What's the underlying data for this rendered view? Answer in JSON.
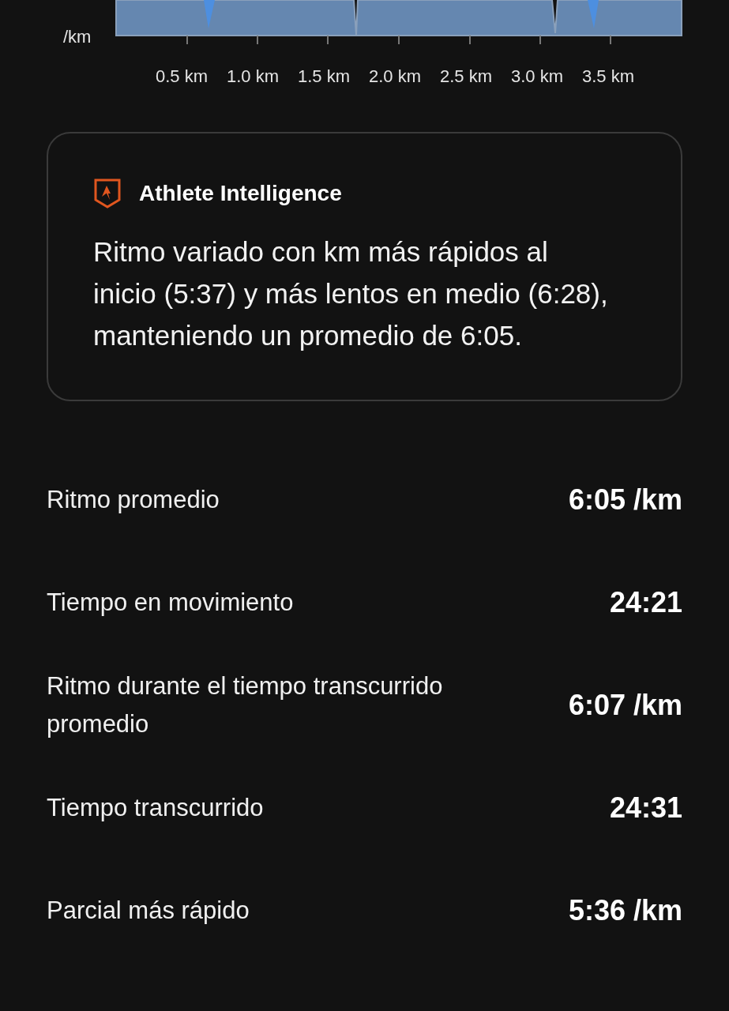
{
  "pace_chart": {
    "unit": "/km",
    "x_labels": [
      "0.5 km",
      "1.0 km",
      "1.5 km",
      "2.0 km",
      "2.5 km",
      "3.0 km",
      "3.5 km"
    ]
  },
  "insight_card": {
    "title": "Athlete Intelligence",
    "text": "Ritmo variado con km más rápidos al inicio (5:37) y más lentos en medio (6:28), manteniendo un promedio de 6:05."
  },
  "stats": [
    {
      "label": "Ritmo promedio",
      "value": "6:05 /km"
    },
    {
      "label": "Tiempo en movimiento",
      "value": "24:21"
    },
    {
      "label": "Ritmo durante el tiempo transcurrido promedio",
      "value": "6:07 /km"
    },
    {
      "label": "Tiempo transcurrido",
      "value": "24:31"
    },
    {
      "label": "Parcial más rápido",
      "value": "5:36 /km"
    }
  ]
}
